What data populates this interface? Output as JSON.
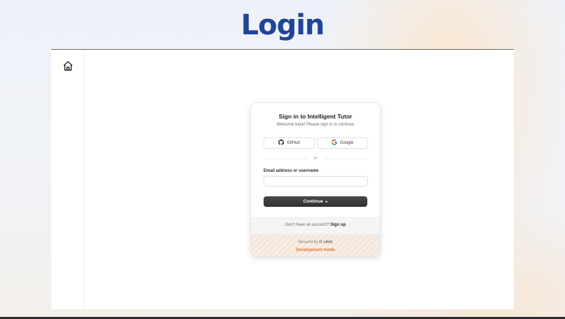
{
  "page": {
    "heading": "Login"
  },
  "sidebar": {
    "home_icon": "home-icon"
  },
  "signin": {
    "title": "Sign in to Intelligent Tutor",
    "subtitle": "Welcome back! Please sign in to continue",
    "github_label": "GitHub",
    "google_label": "Google",
    "divider_text": "or",
    "email_label": "Email address or username",
    "email_value": "",
    "continue_label": "Continue",
    "continue_icon": "▸",
    "signup_prompt": "Don't have an account?",
    "signup_link": "Sign up",
    "secured_by": "Secured by",
    "clerk_brand": "clerk",
    "dev_mode": "Development mode"
  },
  "colors": {
    "heading": "#1f4597",
    "button": "#333335",
    "dev_mode": "#e0782f"
  }
}
